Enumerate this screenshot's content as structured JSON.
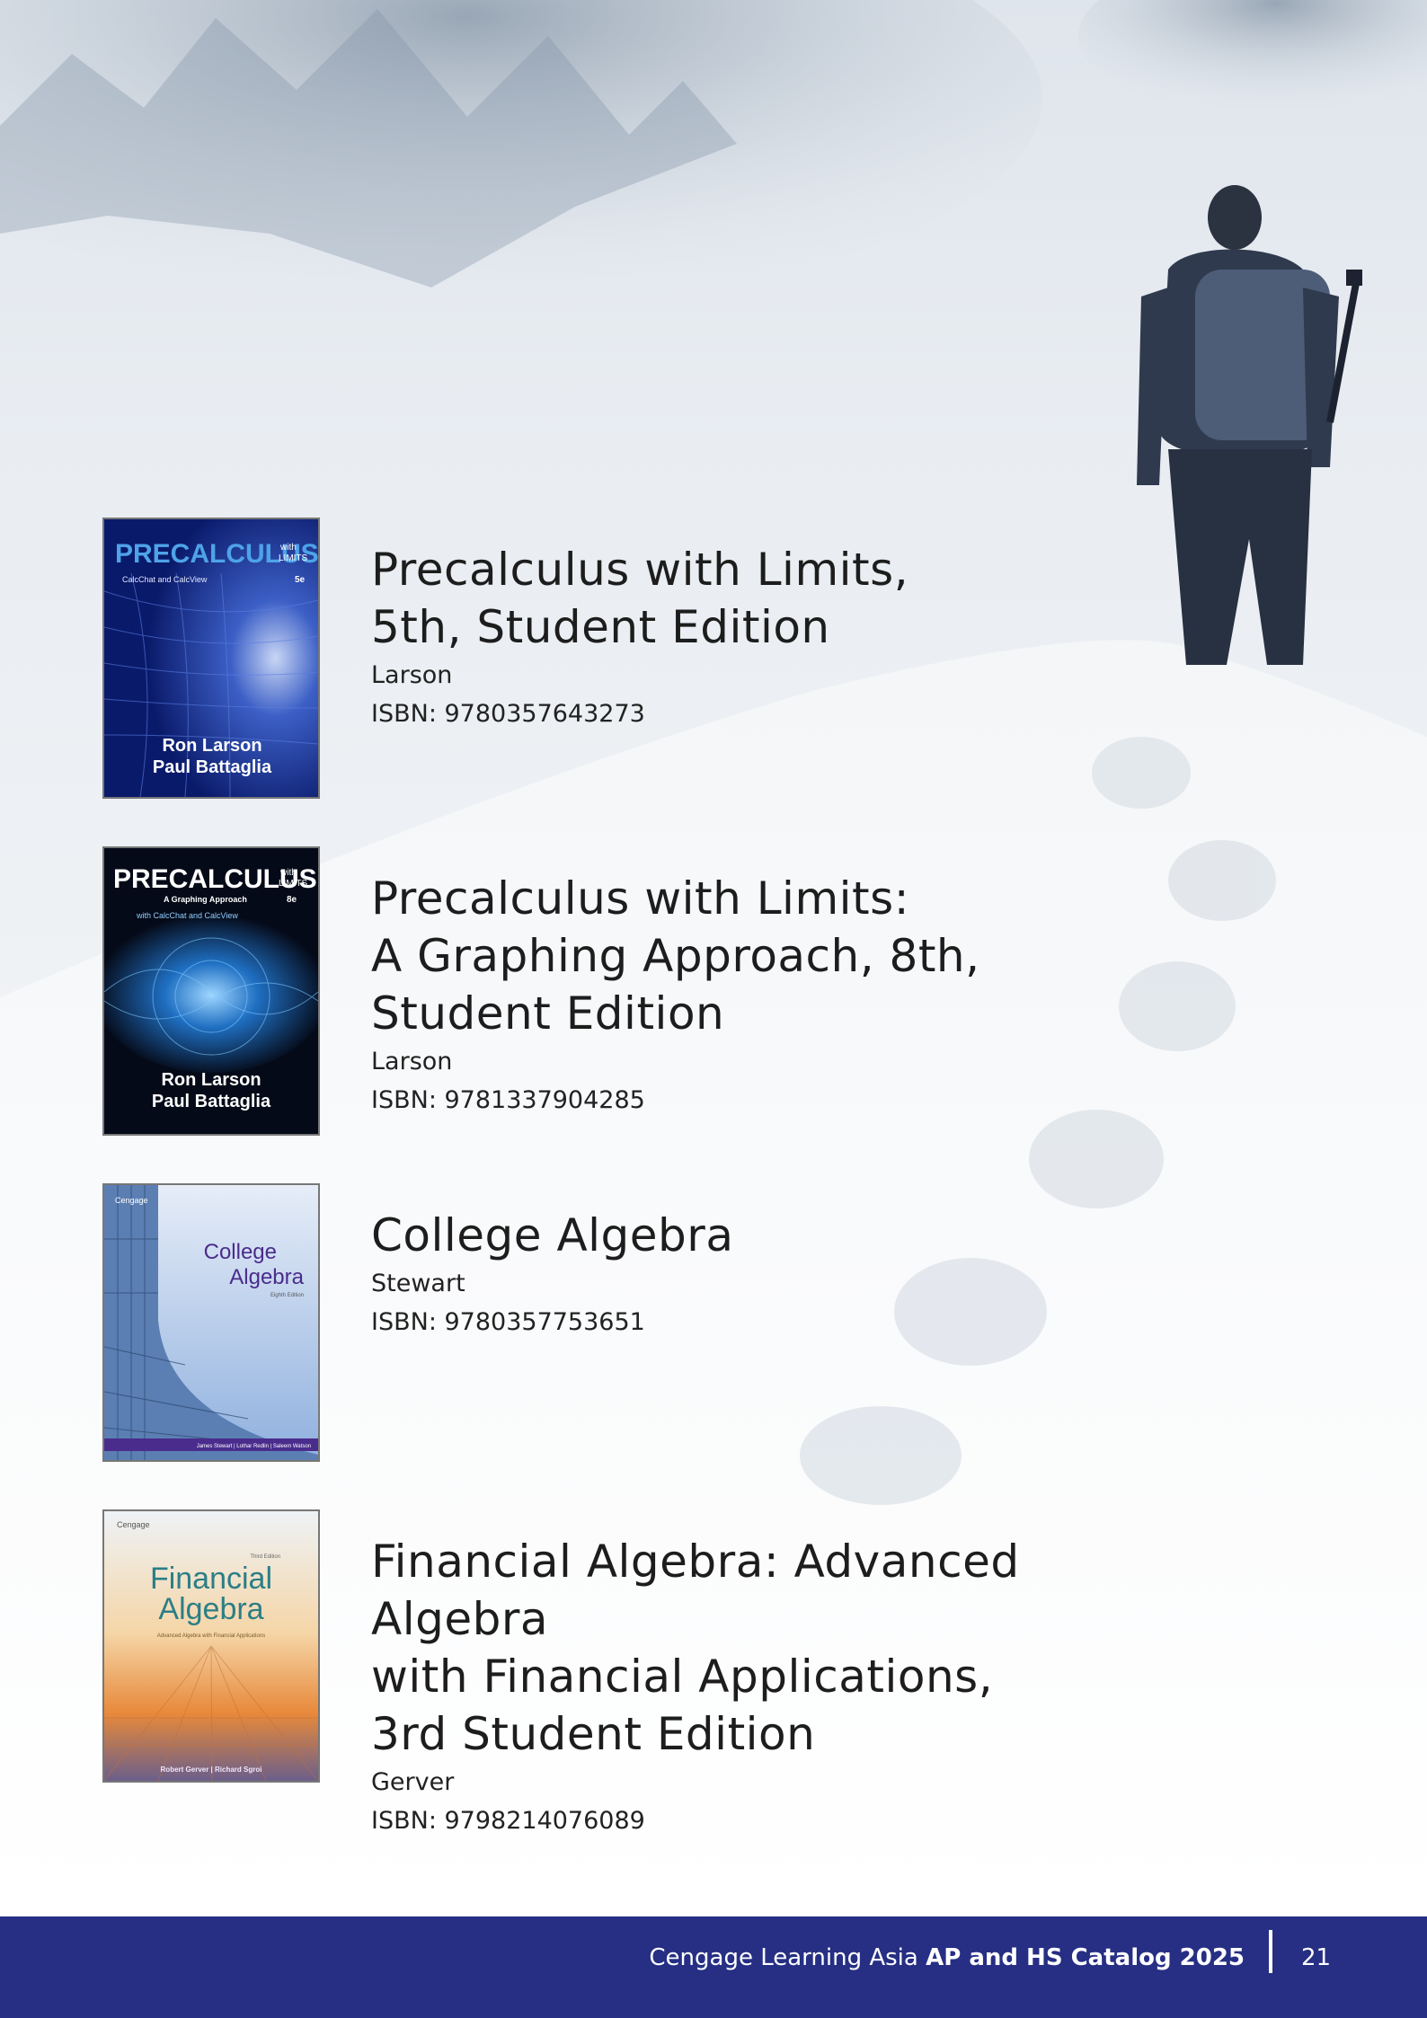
{
  "books": [
    {
      "title_lines": [
        "Precalculus with Limits,",
        "5th, Student Edition"
      ],
      "author": "Larson",
      "isbn": "ISBN: 9780357643273",
      "cover": {
        "title": "PRECALCULUS",
        "with": "with",
        "limits": "LIMITS",
        "tagline": "CalcChat and CalcView",
        "edition": "5e",
        "authors": [
          "Ron Larson",
          "Paul Battaglia"
        ]
      }
    },
    {
      "title_lines": [
        "Precalculus with Limits:",
        "A Graphing Approach, 8th,",
        "Student Edition"
      ],
      "author": "Larson",
      "isbn": "ISBN: 9781337904285",
      "cover": {
        "title": "PRECALCULUS",
        "with": "with",
        "limits": "LIMITS",
        "subtitle": "A Graphing Approach",
        "edition": "8e",
        "tagline": "with CalcChat and CalcView",
        "authors": [
          "Ron Larson",
          "Paul Battaglia"
        ]
      }
    },
    {
      "title_lines": [
        "College Algebra"
      ],
      "author": "Stewart",
      "isbn": "ISBN: 9780357753651",
      "cover": {
        "brand": "Cengage",
        "title_line1": "College",
        "title_line2": "Algebra",
        "edition": "Eighth Edition",
        "authors": "James Stewart | Lothar Redlin | Saleem Watson"
      }
    },
    {
      "title_lines": [
        "Financial Algebra: Advanced Algebra",
        "with Financial Applications,",
        "3rd Student Edition"
      ],
      "author": "Gerver",
      "isbn": "ISBN: 9798214076089",
      "cover": {
        "brand": "Cengage",
        "edition": "Third Edition",
        "title_line1": "Financial",
        "title_line2": "Algebra",
        "subtitle": "Advanced Algebra with Financial Applications",
        "authors": "Robert Gerver | Richard Sgroi"
      }
    }
  ],
  "footer": {
    "publisher": "Cengage Learning Asia ",
    "catalog": "AP and HS Catalog 2025",
    "page_number": "21"
  },
  "colors": {
    "footer_bg": "#262f84",
    "text": "#222222"
  }
}
